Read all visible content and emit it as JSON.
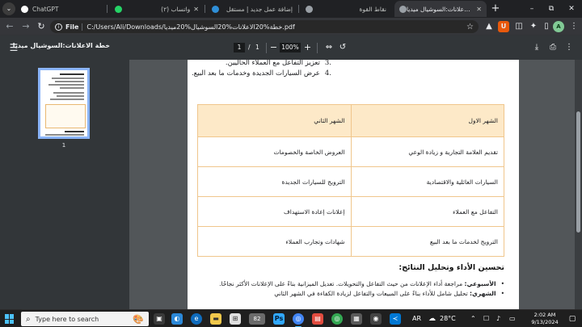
{
  "browser": {
    "tabs": [
      {
        "title": "ChatGPT",
        "favicon": "chatgpt-icon",
        "color": "#ffffff",
        "active": false
      },
      {
        "title": "(٢) واتساب",
        "favicon": "whatsapp-icon",
        "color": "#25d366",
        "active": false
      },
      {
        "title": "إضافة عمل جديد | مستقل",
        "favicon": "mostaql-icon",
        "color": "#2f8fd8",
        "active": false
      },
      {
        "title": "نقاط القوة",
        "favicon": "chrome-page-icon",
        "color": "#9aa0a6",
        "active": false
      },
      {
        "title": "خطة الاعلانات:السوشيال ميديا",
        "favicon": "chrome-page-icon",
        "color": "#9aa0a6",
        "active": true
      }
    ],
    "new_tab_glyph": "+",
    "window_controls": {
      "minimize": "–",
      "maximize": "⧉",
      "close": "✕"
    },
    "address": {
      "chip": "File",
      "url": "C:/Users/Ali/Downloads/خطة%20الاعلانات%20السوشيال%20ميديا.pdf"
    },
    "profile_initial": "A"
  },
  "pdf_toolbar": {
    "title": "خطة الاعلانات:السوشيال ميديا",
    "current_page": "1",
    "page_separator": "/",
    "total_pages": "1",
    "zoom": "100%",
    "zoom_out": "−",
    "zoom_in": "+"
  },
  "sidebar": {
    "thumb_page_number": "1"
  },
  "document": {
    "list_items": [
      {
        "num": ".3",
        "text": "تعزيز التفاعل مع العملاء الحاليين."
      },
      {
        "num": ".4",
        "text": "عرض السيارات الجديدة وخدمات ما بعد البيع."
      }
    ],
    "table": {
      "headers": [
        "الشهر الاول",
        "الشهر الثاني"
      ],
      "rows": [
        [
          "تقديم العلامة التجارية و زيادة الوعي",
          "العروض الخاصة والخصومات"
        ],
        [
          "السيارات العائلية والاقتصادية",
          "الترويج للسيارات الجديدة"
        ],
        [
          "التفاعل مع العملاء",
          "إعلانات إعادة الاستهداف"
        ],
        [
          "الترويج لخدمات ما بعد البيع",
          "شهادات وتجارب العملاء"
        ]
      ]
    },
    "section_heading": "تحسين الأداء وتحليل النتائج:",
    "bullets": [
      {
        "label": "الأسبوعي:",
        "text": " مراجعة أداء الإعلانات من حيث التفاعل والتحويلات. تعديل الميزانية بناءً على الإعلانات الأكثر نجاحًا."
      },
      {
        "label": "الشهري:",
        "text": " تحليل شامل للأداء بناءً على المبيعات والتفاعل لزيادة الكفاءة في الشهر الثاني"
      }
    ]
  },
  "taskbar": {
    "search_placeholder": "Type here to search",
    "badge_count": "82",
    "language": "AR",
    "temperature": "28°C",
    "time": "2:02 AM",
    "date": "9/13/2024"
  },
  "colors": {
    "accent": "#8ab4f8",
    "table_border": "#f0c68c",
    "table_header_bg": "#fde9c8",
    "windows_blue": "#4cc2ff"
  }
}
